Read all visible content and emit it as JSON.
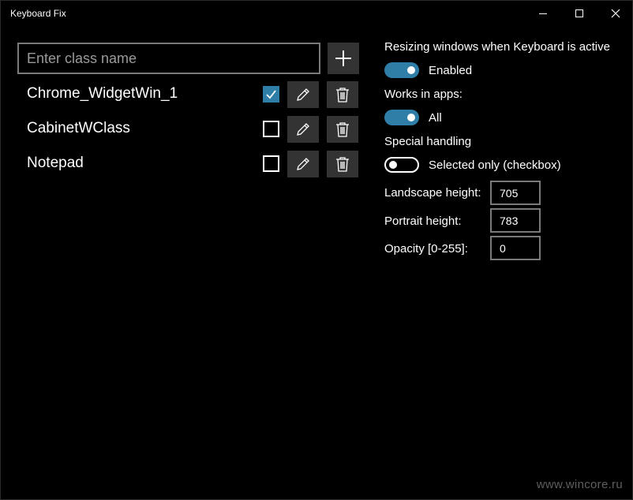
{
  "window": {
    "title": "Keyboard Fix",
    "accent_color": "#2f7ea8"
  },
  "class_input": {
    "value": "",
    "placeholder": "Enter class name"
  },
  "add_button": {
    "icon": "plus-icon"
  },
  "class_list": [
    {
      "name": "Chrome_WidgetWin_1",
      "checked": true
    },
    {
      "name": "CabinetWClass",
      "checked": false
    },
    {
      "name": "Notepad",
      "checked": false
    }
  ],
  "settings": {
    "resizing_label": "Resizing windows when Keyboard is active",
    "resizing_toggle": {
      "on": true,
      "text": "Enabled"
    },
    "works_in_label": "Works in apps:",
    "works_in_toggle": {
      "on": true,
      "text": "All"
    },
    "special_label": "Special handling",
    "special_toggle": {
      "on": false,
      "text": "Selected only (checkbox)"
    },
    "landscape_label": "Landscape height:",
    "landscape_value": "705",
    "portrait_label": "Portrait height:",
    "portrait_value": "783",
    "opacity_label": "Opacity [0-255]:",
    "opacity_value": "0"
  },
  "watermark": "www.wincore.ru"
}
